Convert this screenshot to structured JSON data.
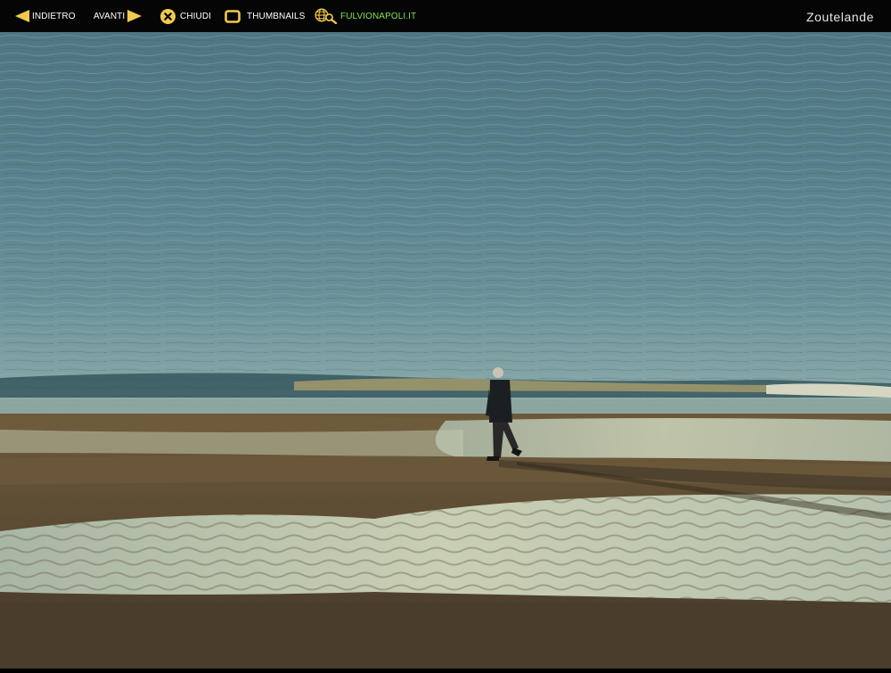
{
  "toolbar": {
    "back_label": "INDIETRO",
    "next_label": "AVANTI",
    "close_label": "CHIUDI",
    "thumbnails_label": "THUMBNAILS",
    "site_label": "FULVIONAPOLI.IT",
    "icons": {
      "back": "arrow-left-icon",
      "next": "arrow-right-icon",
      "close": "close-circle-icon",
      "thumbnails": "thumbnails-square-icon",
      "site": "globe-search-icon"
    },
    "colors": {
      "background": "#050505",
      "icon": "#f2c94c",
      "text": "#ffffff",
      "site_link": "#7fe05a"
    }
  },
  "photo": {
    "title": "Zoutelande",
    "subject": "beach-photo"
  }
}
